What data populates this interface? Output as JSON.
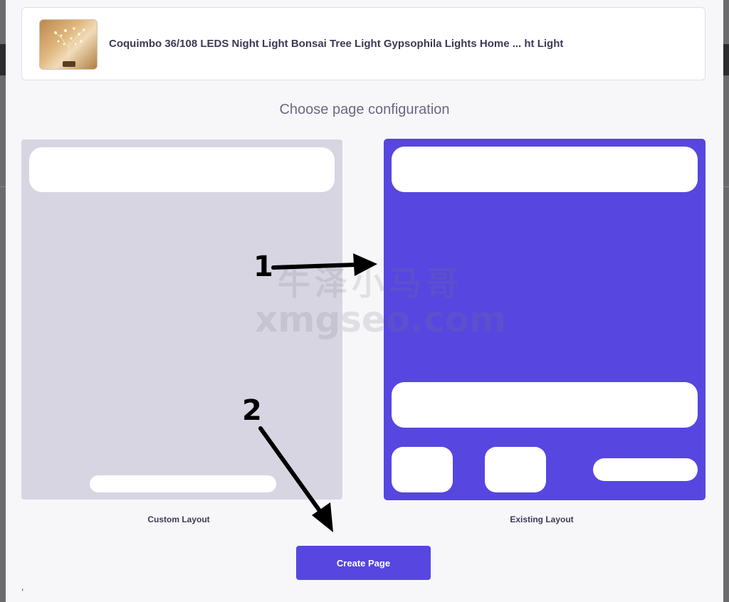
{
  "product": {
    "title": "Coquimbo 36/108 LEDS Night Light Bonsai Tree Light Gypsophila Lights Home ...  ht Light",
    "thumbnail_icon": "product-photo"
  },
  "config": {
    "heading": "Choose page configuration",
    "options": [
      {
        "label": "Custom Layout",
        "selected": false
      },
      {
        "label": "Existing Layout",
        "selected": true
      }
    ]
  },
  "actions": {
    "create_label": "Create Page"
  },
  "stray_text": ",",
  "watermark": {
    "line1": "牛泽小马哥",
    "line2": "xmgseo.com"
  },
  "annotations": {
    "step1": "1",
    "step2": "2"
  },
  "colors": {
    "accent": "#5746e0",
    "custom_bg": "#d7d5e2",
    "page_bg": "#f7f7fa"
  }
}
